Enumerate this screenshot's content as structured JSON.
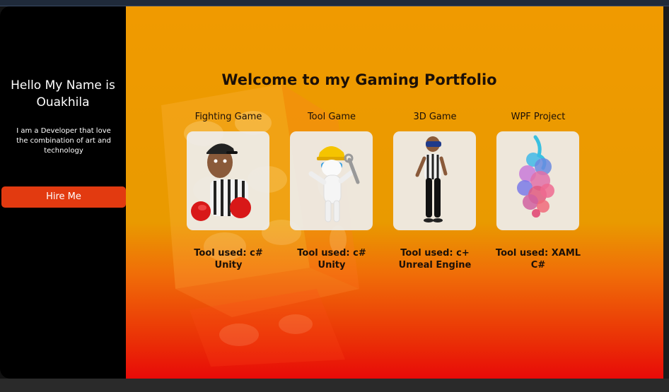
{
  "sidebar": {
    "greeting": "Hello My Name is Ouakhila",
    "tagline": "I am a Developer that love the combination of art and technology",
    "hire_label": "Hire Me",
    "accent": "#e23a10"
  },
  "main": {
    "heading": "Welcome to my Gaming Portfolio",
    "gradient": [
      "#f09a00",
      "#e80a08"
    ],
    "projects": [
      {
        "title": "Fighting Game",
        "tool_line1": "Tool used: c#",
        "tool_line2": "Unity",
        "icon": "boxer-character-icon"
      },
      {
        "title": "Tool Game",
        "tool_line1": "Tool used: c#",
        "tool_line2": "Unity",
        "icon": "builder-character-icon"
      },
      {
        "title": "3D Game",
        "tool_line1": "Tool used: c+",
        "tool_line2": "Unreal Engine",
        "icon": "vr-referee-icon"
      },
      {
        "title": "WPF Project",
        "tool_line1": "Tool used: XAML",
        "tool_line2": "C#",
        "icon": "ink-cloud-icon"
      }
    ]
  }
}
